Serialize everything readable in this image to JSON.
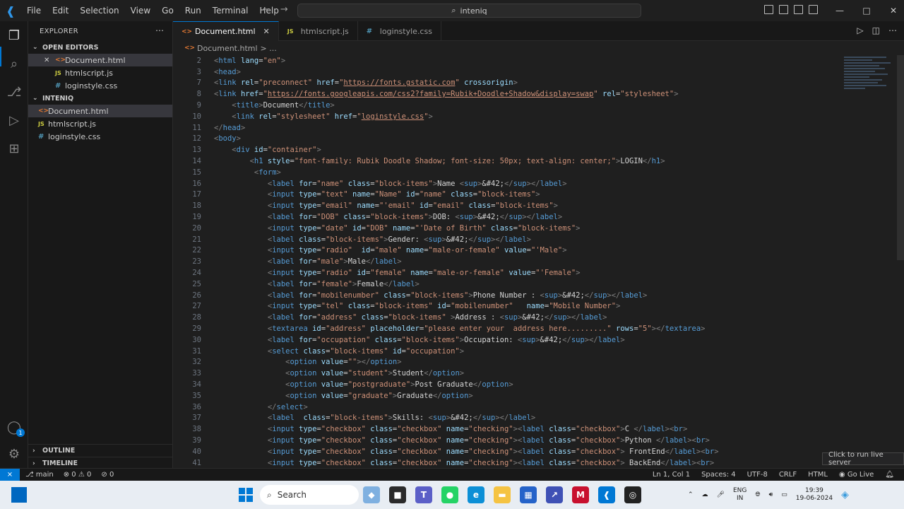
{
  "window": {
    "menu": [
      "File",
      "Edit",
      "Selection",
      "View",
      "Go",
      "Run",
      "Terminal",
      "Help"
    ],
    "search_text": "inteniq"
  },
  "sidebar": {
    "title": "EXPLORER",
    "open_editors_label": "OPEN EDITORS",
    "open_editors": [
      {
        "name": "Document.html",
        "type": "html"
      },
      {
        "name": "htmlscript.js",
        "type": "js"
      },
      {
        "name": "loginstyle.css",
        "type": "css"
      }
    ],
    "project_label": "INTENIQ",
    "project_files": [
      {
        "name": "Document.html",
        "type": "html"
      },
      {
        "name": "htmlscript.js",
        "type": "js"
      },
      {
        "name": "loginstyle.css",
        "type": "css"
      }
    ],
    "outline_label": "OUTLINE",
    "timeline_label": "TIMELINE"
  },
  "tabs": [
    {
      "label": "Document.html",
      "type": "html",
      "active": true
    },
    {
      "label": "htmlscript.js",
      "type": "js",
      "active": false
    },
    {
      "label": "loginstyle.css",
      "type": "css",
      "active": false
    }
  ],
  "breadcrumb": {
    "file": "Document.html",
    "rest": "> ..."
  },
  "code": {
    "line_numbers": [
      "2",
      "3",
      "7",
      "8",
      "9",
      "10",
      "11",
      "12",
      "13",
      "14",
      "15",
      "16",
      "17",
      "18",
      "19",
      "20",
      "21",
      "22",
      "23",
      "24",
      "25",
      "26",
      "27",
      "28",
      "29",
      "30",
      "31",
      "32",
      "33",
      "34",
      "35",
      "36",
      "37",
      "38",
      "39",
      "40",
      "41"
    ]
  },
  "status": {
    "branch": "main",
    "errors": "0",
    "warnings": "0",
    "ports": "0",
    "position": "Ln 1, Col 1",
    "spaces": "Spaces: 4",
    "encoding": "UTF-8",
    "eol": "CRLF",
    "language": "HTML",
    "golive": "Go Live",
    "tooltip": "Click to run live server"
  },
  "taskbar": {
    "search_label": "Search",
    "lang": "ENG",
    "region": "IN",
    "time": "19:39",
    "date": "19-06-2024"
  }
}
